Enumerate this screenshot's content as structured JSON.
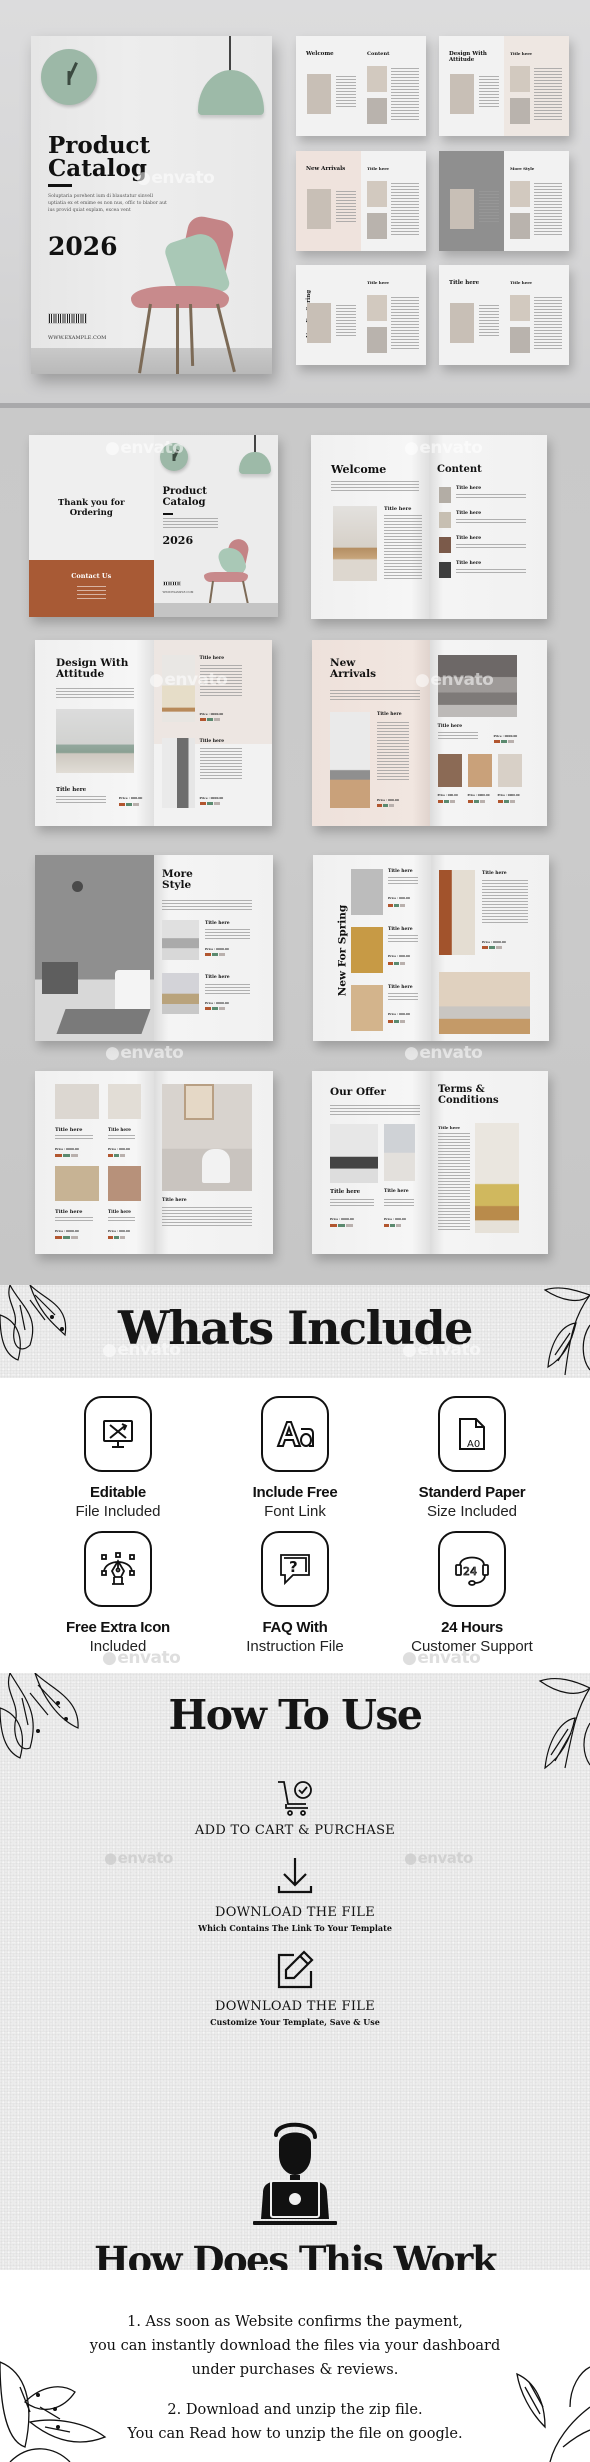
{
  "hero": {
    "cover": {
      "title_line1": "Product",
      "title_line2": "Catalog",
      "body": "Soluptaria porehent ium di blaustatur sinvell uptiatia ex et emime es non nus, offic to blabor aut ius provid quiat explam, excea vent",
      "year": "2026",
      "website": "WWW.EXAMPLE.COM"
    },
    "thumbnails": [
      {
        "left_title": "Welcome",
        "right_title": "Content"
      },
      {
        "left_title": "Design With Attitude",
        "right_title": "Title here"
      },
      {
        "left_title": "New Arrivals",
        "right_title": "Title here"
      },
      {
        "left_title": "",
        "right_title": "More Style"
      },
      {
        "left_title": "New For Spring",
        "right_title": "Title here"
      },
      {
        "left_title": "Title here",
        "right_title": "Title here"
      }
    ]
  },
  "spreads": {
    "watermark": "envato",
    "back_cover": {
      "thank_you_line1": "Thank you for",
      "thank_you_line2": "Ordering",
      "contact_title": "Contact Us",
      "front_title_line1": "Product",
      "front_title_line2": "Catalog",
      "front_year": "2026",
      "front_website": "WWW.EXAMPLE.COM"
    },
    "welcome": {
      "left_title": "Welcome",
      "left_item_title": "Title here",
      "right_title": "Content",
      "items": [
        "Title here",
        "Title here",
        "Title here",
        "Title here"
      ]
    },
    "design": {
      "left_title_line1": "Design With",
      "left_title_line2": "Attitude",
      "left_item_title": "Title here",
      "left_price": "Price : 000.00",
      "right_items": [
        {
          "title": "Title here",
          "price": "Price : 0000.00"
        },
        {
          "title": "Title here",
          "price": "Price : 0000.00"
        }
      ]
    },
    "arrivals": {
      "left_title_line1": "New",
      "left_title_line2": "Arrivals",
      "left_item_title": "Title here",
      "left_price": "Price : 000.00",
      "right_item_title": "Title here",
      "right_price": "Price : 0000.00",
      "small_prices": [
        "Price : 000.00",
        "Price : 0000.00",
        "Price : 0000.00"
      ]
    },
    "more_style": {
      "title_line1": "More",
      "title_line2": "Style",
      "items": [
        {
          "title": "Title here",
          "price": "Price : 0000.00"
        },
        {
          "title": "Title here",
          "price": "Price : 0000.00"
        }
      ]
    },
    "spring": {
      "vertical_title": "New For Spring",
      "left_items": [
        {
          "title": "Title here",
          "price": "Price : 000.00"
        },
        {
          "title": "Title here",
          "price": "Price : 000.00"
        },
        {
          "title": "Title here",
          "price": "Price : 000.00"
        }
      ],
      "right_item_title": "Title here",
      "right_price": "Price : 0000.00"
    },
    "grid": {
      "items": [
        {
          "title": "Title here",
          "price": "Price : 0000.00"
        },
        {
          "title": "Title here",
          "price": "Price : 000.00"
        },
        {
          "title": "Title here",
          "price": "Price : 0000.00"
        },
        {
          "title": "Title here",
          "price": "Price : 000.00"
        }
      ],
      "right_title": "Title here"
    },
    "offer": {
      "left_title": "Our Offer",
      "items": [
        {
          "title": "Title here",
          "price": "Price : 0000.00"
        },
        {
          "title": "Title here",
          "price": "Price : 000.00"
        }
      ],
      "right_title_line1": "Terms &",
      "right_title_line2": "Conditions",
      "right_item_title": "Title here"
    }
  },
  "whats_include": {
    "title": "Whats Include",
    "features": [
      {
        "icon": "edit-design-icon",
        "line1": "Editable",
        "line2": "File Included"
      },
      {
        "icon": "font-aa-icon",
        "line1": "Include Free",
        "line2": "Font Link"
      },
      {
        "icon": "paper-size-a0-icon",
        "line1": "Standerd Paper",
        "line2": "Size Included"
      },
      {
        "icon": "pen-tool-icon",
        "line1": "Free Extra Icon",
        "line2": "Included"
      },
      {
        "icon": "faq-question-icon",
        "line1": "FAQ With",
        "line2": "Instruction File"
      },
      {
        "icon": "support-24-icon",
        "line1": "24 Hours",
        "line2": "Customer Support"
      }
    ]
  },
  "how_to_use": {
    "title": "How To Use",
    "steps": [
      {
        "icon": "cart-check-icon",
        "label": "ADD TO CART & PURCHASE",
        "sub": ""
      },
      {
        "icon": "download-icon",
        "label": "DOWNLOAD THE FILE",
        "sub": "Which Contains The Link To Your Template"
      },
      {
        "icon": "edit-pencil-icon",
        "label": "DOWNLOAD THE FILE",
        "sub": "Customize Your Template, Save & Use"
      }
    ]
  },
  "how_does_this_work": {
    "title": "How Does This Work",
    "notes": [
      [
        "1. Ass soon as Website confirms the payment,",
        "you can instantly download the files via your dashboard",
        "under purchases & reviews."
      ],
      [
        "2. Download and unzip the zip file.",
        "You can Read how to unzip the file on google."
      ]
    ]
  }
}
